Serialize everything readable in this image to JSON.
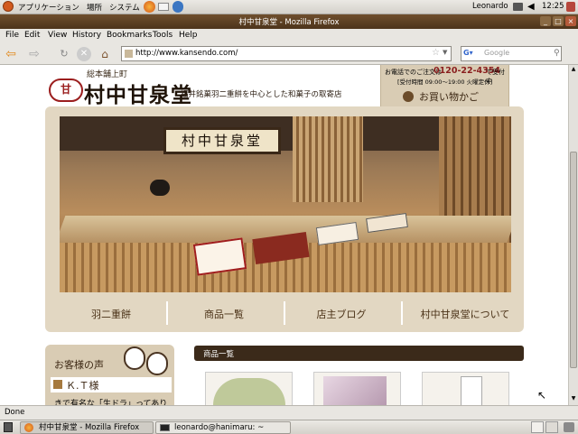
{
  "panel": {
    "menus": [
      "アプリケーション",
      "場所",
      "システム"
    ],
    "user": "Leonardo",
    "clock": "12:25"
  },
  "window": {
    "title": "村中甘泉堂 - Mozilla Firefox",
    "buttons": [
      "_",
      "□",
      "×"
    ]
  },
  "menubar": [
    "File",
    "Edit",
    "View",
    "History",
    "Bookmarks",
    "Tools",
    "Help"
  ],
  "navbar": {
    "url": "http://www.kansendo.com/",
    "search_placeholder": "Google"
  },
  "site": {
    "logo_small": "総本舗上町",
    "logo_main": "村中甘泉堂",
    "tagline": "福井銘菓羽二重餅を中心とした和菓子の取寄店",
    "phone_prefix": "お電話でのご注文は",
    "phone": "0120-22-4354",
    "phone_suffix": "で受付中",
    "hours": "[受付時間 09:00～19:00 火曜定休]",
    "cart_label": "お買い物かご",
    "signboard": "村中甘泉堂",
    "nav": [
      "羽二重餅",
      "商品一覧",
      "店主ブログ",
      "村中甘泉堂について"
    ],
    "voice_heading": "お客様の声",
    "voice_name": "Ｋ.Ｔ様",
    "voice_text": "きで有名な「生ドラ」ってありま",
    "products_heading": "商品一覧"
  },
  "status": "Done",
  "taskbar": {
    "items": [
      "村中甘泉堂 - Mozilla Firefox",
      "leonardo@hanimaru: ~"
    ]
  }
}
